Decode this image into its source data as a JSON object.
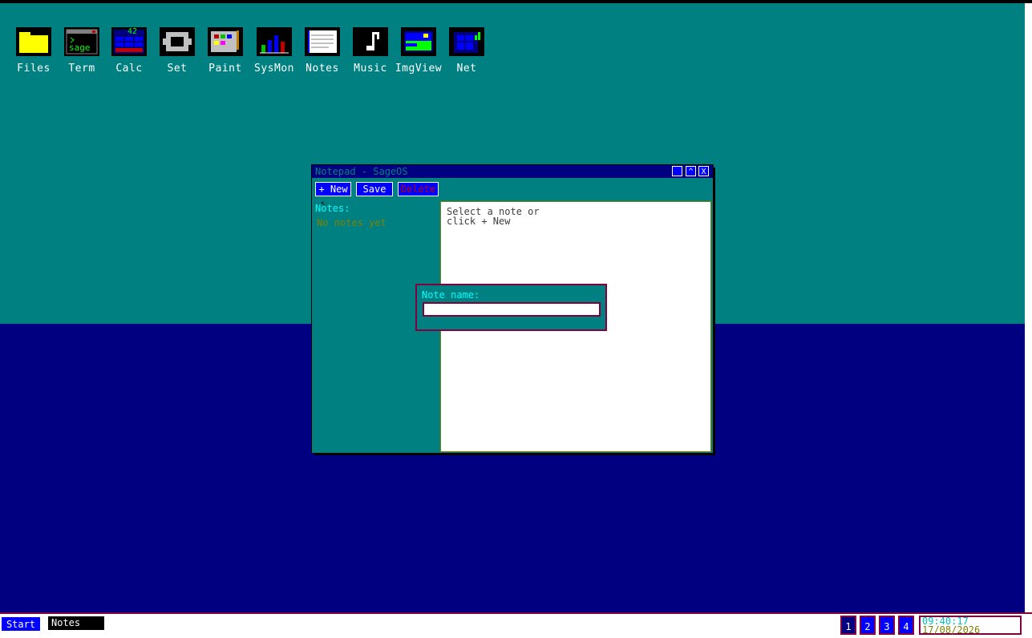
{
  "desktop_icons": [
    {
      "name": "Files",
      "icon": "folder-icon"
    },
    {
      "name": "Term",
      "icon": "terminal-icon"
    },
    {
      "name": "Calc",
      "icon": "calculator-icon"
    },
    {
      "name": "Set",
      "icon": "gear-icon"
    },
    {
      "name": "Paint",
      "icon": "palette-icon"
    },
    {
      "name": "SysMon",
      "icon": "bar-chart-icon"
    },
    {
      "name": "Notes",
      "icon": "notepad-icon"
    },
    {
      "name": "Music",
      "icon": "music-note-icon"
    },
    {
      "name": "ImgView",
      "icon": "image-icon"
    },
    {
      "name": "Net",
      "icon": "network-icon"
    }
  ],
  "terminal_icon_text": "sage",
  "calc_icon_text": "42",
  "window": {
    "title": "Notepad - SageOS",
    "minimize": "_",
    "maximize": "^",
    "close": "X",
    "toolbar": {
      "new": "+ New",
      "save": "Save",
      "delete": "Delete"
    },
    "sidebar_label": "Notes:",
    "sidebar_empty": "No notes yet",
    "editor_placeholder": "Select a note or\nclick + New"
  },
  "dialog": {
    "label": "Note name:",
    "value": ""
  },
  "taskbar": {
    "start": "Start",
    "task": "Notes",
    "workspaces": [
      "1",
      "2",
      "3",
      "4"
    ],
    "time": "09:40:17",
    "date": "17/08/2026"
  },
  "colors": {
    "desktop_teal": "#008080",
    "desktop_navy": "#000080",
    "accent_blue": "#0000ff",
    "border_maroon": "#800040"
  }
}
